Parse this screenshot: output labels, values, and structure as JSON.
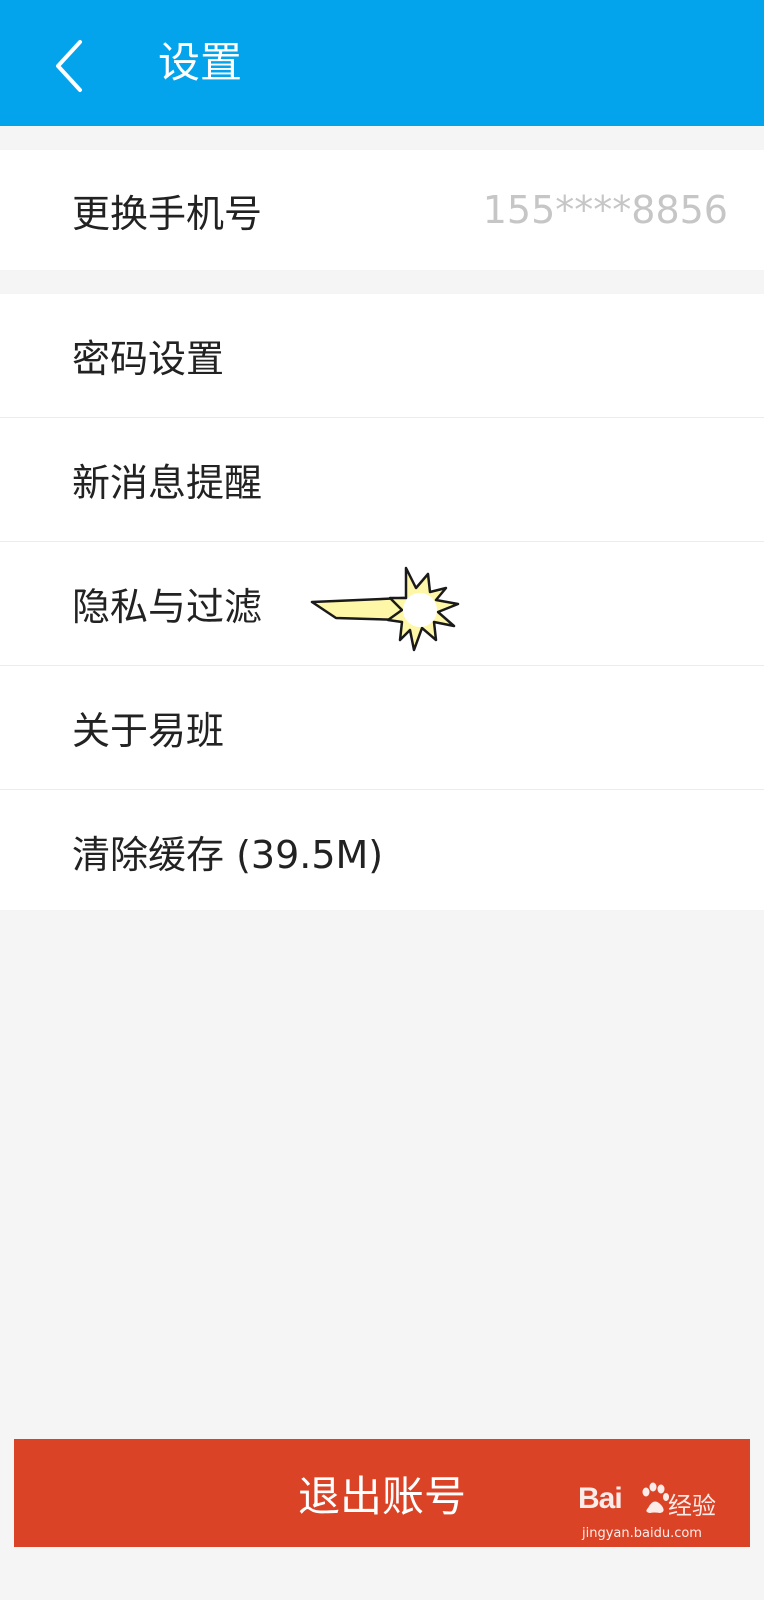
{
  "header": {
    "title": "设置",
    "back_icon": "chevron-left-icon",
    "background": "#03a4ec"
  },
  "account_section": {
    "items": [
      {
        "label": "更换手机号",
        "value": "155****8856"
      }
    ]
  },
  "settings_section": {
    "items": [
      {
        "label": "密码设置"
      },
      {
        "label": "新消息提醒"
      },
      {
        "label": "隐私与过滤"
      },
      {
        "label": "关于易班"
      },
      {
        "label": "清除缓存 (39.5M)"
      }
    ]
  },
  "annotation": {
    "icon": "pointer-arrow-burst-icon"
  },
  "logout_button": {
    "label": "退出账号",
    "color": "#db4326"
  },
  "watermark": {
    "brand": "Bai",
    "brand_suffix": "经验",
    "domain": "jingyan.baidu.com"
  }
}
